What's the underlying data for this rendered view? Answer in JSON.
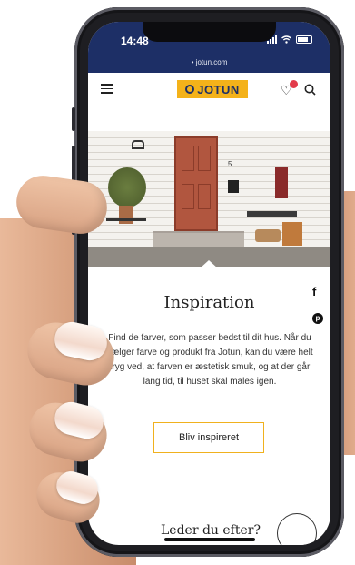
{
  "status_bar": {
    "time": "14:48"
  },
  "browser": {
    "url": "jotun.com"
  },
  "header": {
    "logo_text": "JOTUN",
    "favorites_badge_count": "0",
    "icons": [
      "menu-icon",
      "heart-icon",
      "search-icon"
    ]
  },
  "hero": {
    "house_number": "5"
  },
  "content": {
    "title": "Inspiration",
    "body": "Find de farver, som passer bedst til dit hus. Når du vælger farve og produkt fra Jotun, kan du være helt tryg ved, at farven er æstetisk smuk, og at der går lang tid, til huset skal males igen.",
    "cta_label": "Bliv inspireret"
  },
  "social": {
    "facebook": "f",
    "pinterest": "p"
  },
  "footer": {
    "prompt": "Leder du efter?"
  },
  "colors": {
    "brand_navy": "#1d2f66",
    "brand_yellow": "#f4b21a",
    "badge_red": "#e23b4a",
    "cta_border": "#f0b11e"
  }
}
